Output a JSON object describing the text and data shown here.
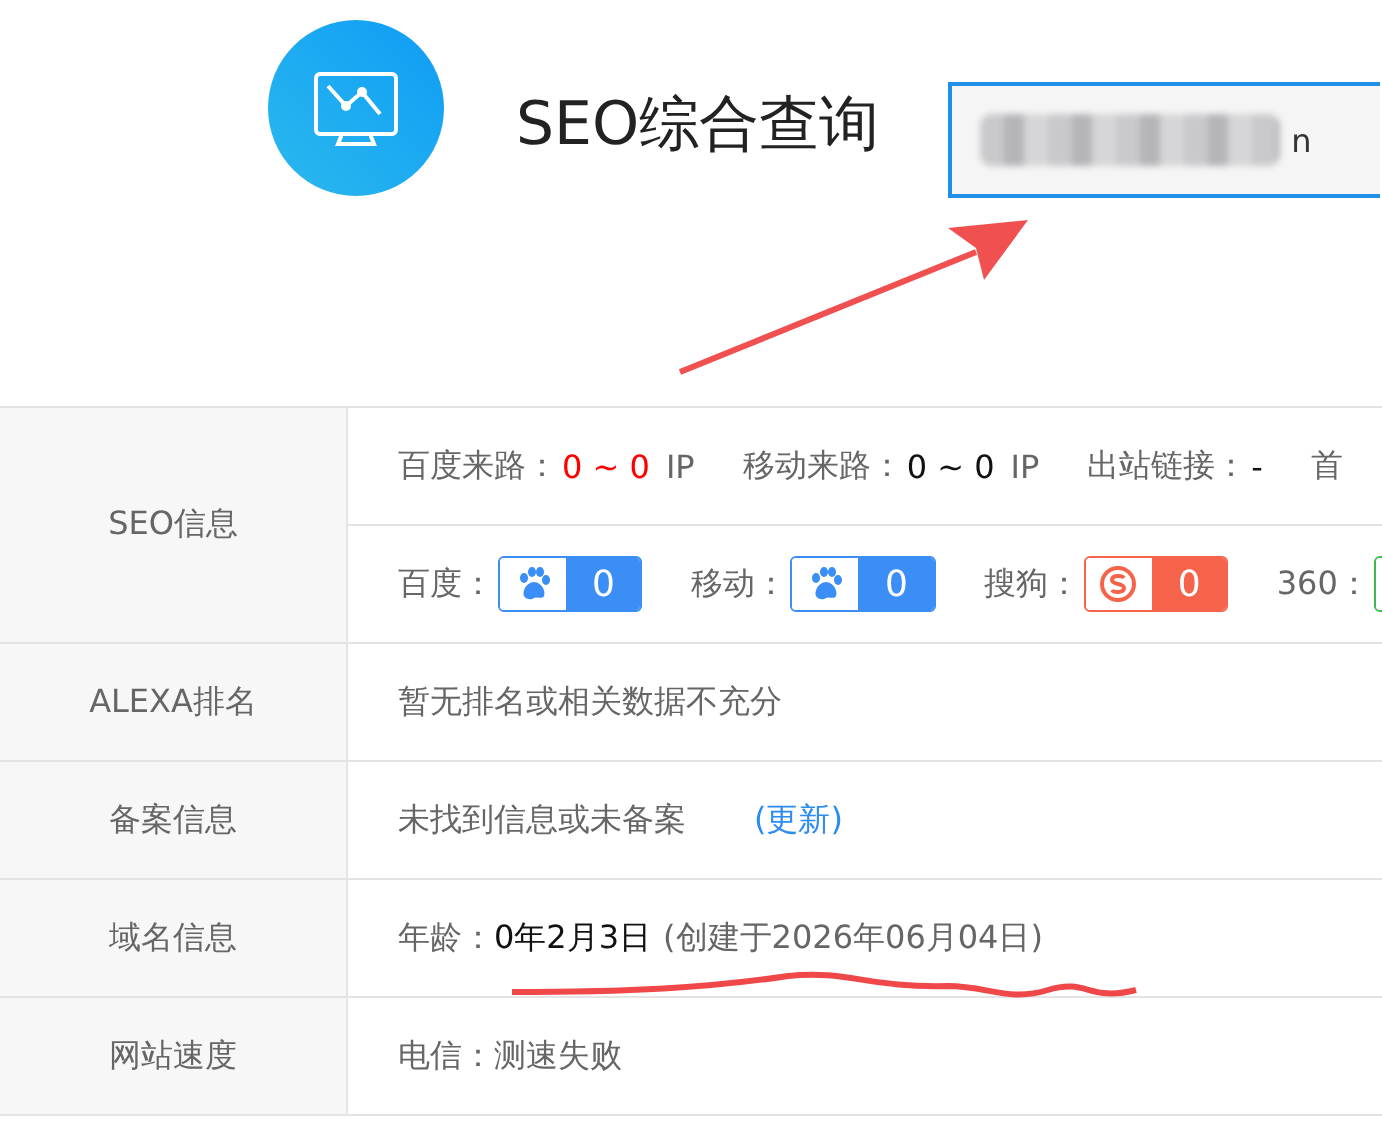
{
  "header": {
    "title": "SEO综合查询",
    "search": {
      "value": "n",
      "redacted": true
    }
  },
  "table": {
    "rows": [
      {
        "kind": "seo",
        "label": "SEO信息",
        "traffic": [
          {
            "label": "百度来路：",
            "value": "0 ~ 0",
            "unit": "IP",
            "highlight": true
          },
          {
            "label": "移动来路：",
            "value": "0 ~ 0",
            "unit": "IP",
            "highlight": false
          },
          {
            "label": "出站链接：",
            "value": "-",
            "highlight": false
          },
          {
            "label": "首"
          }
        ],
        "indexes": [
          {
            "label": "百度：",
            "kind": "paw",
            "color": "#3a8ef6",
            "count": "0"
          },
          {
            "label": "移动：",
            "kind": "mpaw",
            "color": "#3a8ef6",
            "count": "0"
          },
          {
            "label": "搜狗：",
            "kind": "sogou",
            "color": "#f5634a",
            "count": "0"
          },
          {
            "label": "360：",
            "kind": "ring",
            "color": "#3cb950"
          }
        ]
      },
      {
        "kind": "text",
        "label": "ALEXA排名",
        "text": "暂无排名或相关数据不充分"
      },
      {
        "kind": "text",
        "label": "备案信息",
        "text": "未找到信息或未备案",
        "link": "(更新)"
      },
      {
        "kind": "age",
        "label": "域名信息",
        "prefix": "年龄：",
        "age": "0年2月3日",
        "created": "(创建于2026年06月04日)"
      },
      {
        "kind": "text",
        "label": "网站速度",
        "text": "电信：测速失败"
      }
    ]
  }
}
